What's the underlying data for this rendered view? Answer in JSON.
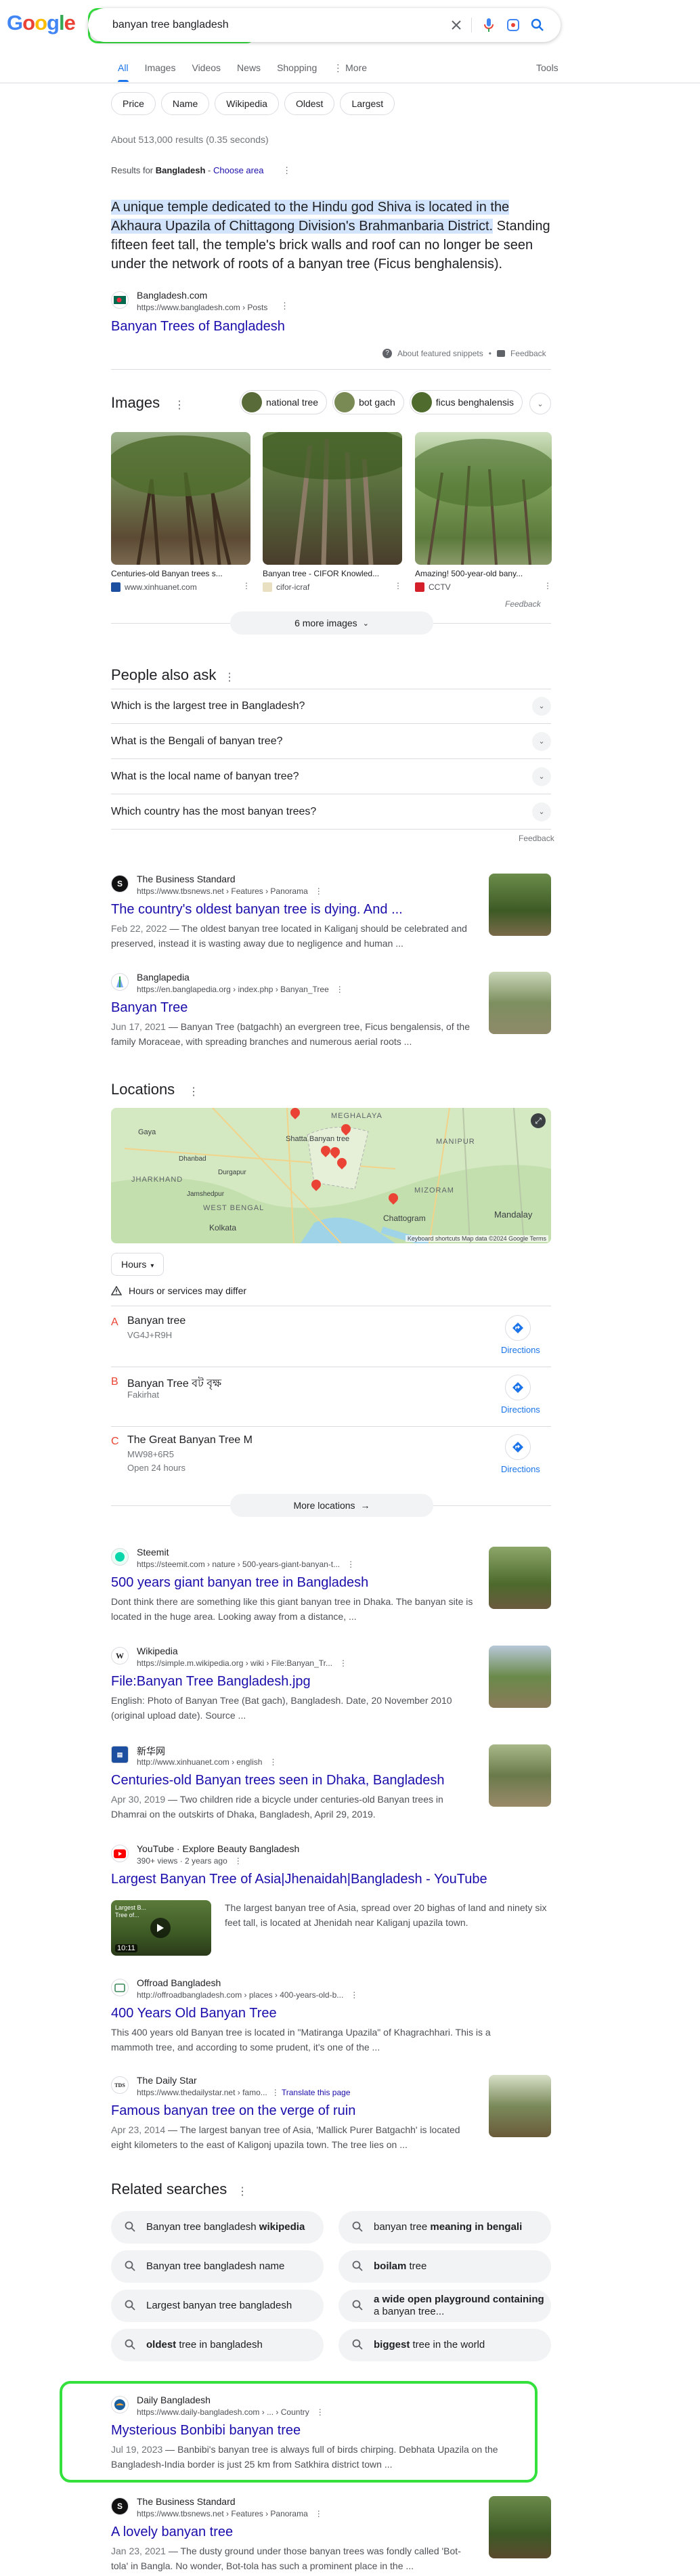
{
  "header": {
    "logo": "Google",
    "query": "banyan tree bangladesh",
    "tabs": [
      "All",
      "Images",
      "Videos",
      "News",
      "Shopping",
      "More"
    ],
    "tools": "Tools",
    "filter_chips": [
      "Price",
      "Name",
      "Wikipedia",
      "Oldest",
      "Largest"
    ]
  },
  "stats": "About 513,000 results (0.35 seconds)",
  "results_for": {
    "prefix": "Results for ",
    "place": "Bangladesh",
    "sep": " - ",
    "link": "Choose area"
  },
  "featured": {
    "highlighted": "A unique temple dedicated to the Hindu god Shiva is located in the Akhaura Upazila of Chittagong Division's Brahmanbaria District.",
    "rest": " Standing fifteen feet tall, the temple's brick walls and roof can no longer be seen under the network of roots of a banyan tree (Ficus benghalensis).",
    "source_name": "Bangladesh.com",
    "source_url": "https://www.bangladesh.com › Posts",
    "title": "Banyan Trees of Bangladesh",
    "about": "About featured snippets",
    "feedback": "Feedback"
  },
  "images": {
    "title": "Images",
    "chips": [
      "national tree",
      "bot gach",
      "ficus benghalensis"
    ],
    "cards": [
      {
        "caption": "Centuries-old Banyan trees s...",
        "source": "www.xinhuanet.com"
      },
      {
        "caption": "Banyan tree - CIFOR Knowled...",
        "source": "cifor-icraf"
      },
      {
        "caption": "Amazing! 500-year-old bany...",
        "source": "CCTV"
      }
    ],
    "feedback": "Feedback",
    "more": "6 more images"
  },
  "paa": {
    "title": "People also ask",
    "questions": [
      "Which is the largest tree in Bangladesh?",
      "What is the Bengali of banyan tree?",
      "What is the local name of banyan tree?",
      "Which country has the most banyan trees?"
    ],
    "feedback": "Feedback"
  },
  "results_a": [
    {
      "site": "The Business Standard",
      "url": "https://www.tbsnews.net › Features › Panorama",
      "title": "The country's oldest banyan tree is dying. And ...",
      "date": "Feb 22, 2022",
      "snippet": " — The oldest banyan tree located in Kaliganj should be celebrated and preserved, instead it is wasting away due to negligence and human ...",
      "fav": "S"
    },
    {
      "site": "Banglapedia",
      "url": "https://en.banglapedia.org › index.php › Banyan_Tree",
      "title": "Banyan Tree",
      "date": "Jun 17, 2021",
      "snippet": " — Banyan Tree (batgachh) an evergreen tree, Ficus bengalensis, of the family Moraceae, with spreading branches and numerous aerial roots ...",
      "fav": "B"
    }
  ],
  "locations": {
    "title": "Locations",
    "map_labels": [
      "MEGHALAYA",
      "Gaya",
      "Shatta Banyan tree",
      "JHARKHAND",
      "WEST BENGAL",
      "MANIPUR",
      "MIZORAM",
      "Chattogram",
      "Kolkata",
      "Mandalay",
      "Dhanbad",
      "Jamshedpur",
      "Durgapur"
    ],
    "map_footer": "Keyboard shortcuts   Map data ©2024 Google   Terms",
    "hours_chip": "Hours",
    "warning": "Hours or services may differ",
    "places": [
      {
        "letter": "A",
        "name": "Banyan tree",
        "sub1": "VG4J+R9H",
        "sub2": ""
      },
      {
        "letter": "B",
        "name": "Banyan Tree বট বৃক্ষ",
        "sub1": "Fakirhat",
        "sub2": ""
      },
      {
        "letter": "C",
        "name": "The Great Banyan Tree M",
        "sub1": "MW98+6R5",
        "sub2": "Open 24 hours"
      }
    ],
    "directions": "Directions",
    "more": "More locations"
  },
  "results_b": [
    {
      "site": "Steemit",
      "url": "https://steemit.com › nature › 500-years-giant-banyan-t...",
      "title": "500 years giant banyan tree in Bangladesh",
      "date": "",
      "snippet": "Dont think there are something like this giant banyan tree in Dhaka. The banyan site is located in the huge area. Looking away from a distance, ...",
      "fav": "S"
    },
    {
      "site": "Wikipedia",
      "url": "https://simple.m.wikipedia.org › wiki › File:Banyan_Tr...",
      "title": "File:Banyan Tree Bangladesh.jpg",
      "date": "",
      "snippet": "English: Photo of Banyan Tree (Bat gach), Bangladesh. Date, 20 November 2010 (original upload date). Source ...",
      "fav": "W"
    },
    {
      "site": "新华网",
      "url": "http://www.xinhuanet.com › english",
      "title": "Centuries-old Banyan trees seen in Dhaka, Bangladesh",
      "date": "Apr 30, 2019",
      "snippet": " — Two children ride a bicycle under centuries-old Banyan trees in Dhamrai on the outskirts of Dhaka, Bangladesh, April 29, 2019.",
      "fav": "X"
    }
  ],
  "youtube": {
    "site": "YouTube · Explore Beauty Bangladesh",
    "sub": "390+ views · 2 years ago",
    "title": "Largest Banyan Tree of Asia|Jhenaidah|Bangladesh - YouTube",
    "snippet": "The largest banyan tree of Asia, spread over 20 bighas of land and ninety six feet tall, is located at Jhenidah near Kaliganj upazila town.",
    "duration": "10:11",
    "overlay": "Largest B... Tree of..."
  },
  "results_c": [
    {
      "site": "Offroad Bangladesh",
      "url": "http://offroadbangladesh.com › places › 400-years-old-b...",
      "title": "400 Years Old Banyan Tree",
      "date": "",
      "snippet": "This 400 years old Banyan tree is located in \"Matiranga Upazila\" of Khagrachhari. This is a mammoth tree, and according to some prudent, it's one of the ...",
      "fav": "O"
    },
    {
      "site": "The Daily Star",
      "url": "https://www.thedailystar.net › famo...",
      "translate": "Translate this page",
      "title": "Famous banyan tree on the verge of ruin",
      "date": "Apr 23, 2014",
      "snippet": " — The largest banyan tree of Asia, 'Mallick Purer Batgachh' is located eight kilometers to the east of Kaligonj upazila town. The tree lies on ...",
      "fav": "D"
    }
  ],
  "related": {
    "title": "Related searches",
    "items": [
      {
        "pre": "Banyan tree bangladesh ",
        "bold": "wikipedia",
        "post": ""
      },
      {
        "pre": "banyan tree ",
        "bold": "meaning in bengali",
        "post": ""
      },
      {
        "pre": "Banyan tree bangladesh name",
        "bold": "",
        "post": ""
      },
      {
        "pre": "",
        "bold": "boilam",
        "post": " tree"
      },
      {
        "pre": "Largest banyan tree bangladesh",
        "bold": "",
        "post": ""
      },
      {
        "pre": "",
        "bold": "a wide open playground containing",
        "post": " a banyan tree..."
      },
      {
        "pre": "",
        "bold": "oldest",
        "post": " tree in bangladesh"
      },
      {
        "pre": "",
        "bold": "biggest",
        "post": " tree in the world"
      }
    ]
  },
  "results_d": [
    {
      "site": "Daily Bangladesh",
      "url": "https://www.daily-bangladesh.com › ... › Country",
      "title": "Mysterious Bonbibi banyan tree",
      "date": "Jul 19, 2023",
      "snippet": " — Banbibi's banyan tree is always full of birds chirping. Debhata Upazila on the Bangladesh-India border is just 25 km from Satkhira district town ...",
      "fav": "D"
    },
    {
      "site": "The Business Standard",
      "url": "https://www.tbsnews.net › Features › Panorama",
      "title": "A lovely banyan tree",
      "date": "Jan 23, 2021",
      "snippet": " — The dusty ground under those banyan trees was fondly called 'Bot-tola' in Bangla. No wonder, Bot-tola has such a prominent place in the ...",
      "fav": "S"
    }
  ],
  "colors": {
    "link": "#1a0dab",
    "accent": "#1a73e8",
    "highlight": "#33e03c",
    "pin": "#ea4335"
  }
}
